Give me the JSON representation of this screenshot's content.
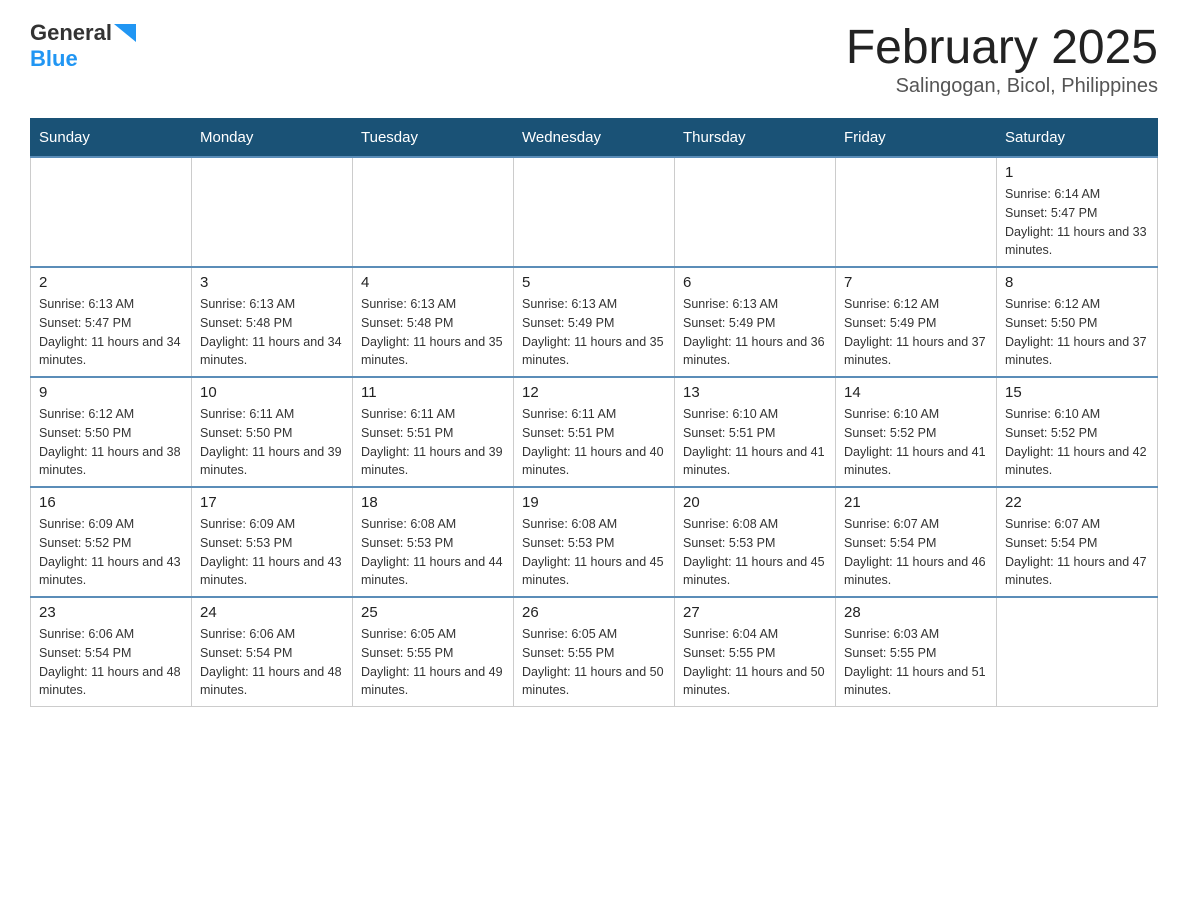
{
  "logo": {
    "general": "General",
    "blue": "Blue",
    "arrow": "▲"
  },
  "header": {
    "month": "February 2025",
    "location": "Salingogan, Bicol, Philippines"
  },
  "weekdays": [
    "Sunday",
    "Monday",
    "Tuesday",
    "Wednesday",
    "Thursday",
    "Friday",
    "Saturday"
  ],
  "weeks": [
    [
      {
        "day": "",
        "info": ""
      },
      {
        "day": "",
        "info": ""
      },
      {
        "day": "",
        "info": ""
      },
      {
        "day": "",
        "info": ""
      },
      {
        "day": "",
        "info": ""
      },
      {
        "day": "",
        "info": ""
      },
      {
        "day": "1",
        "info": "Sunrise: 6:14 AM\nSunset: 5:47 PM\nDaylight: 11 hours and 33 minutes."
      }
    ],
    [
      {
        "day": "2",
        "info": "Sunrise: 6:13 AM\nSunset: 5:47 PM\nDaylight: 11 hours and 34 minutes."
      },
      {
        "day": "3",
        "info": "Sunrise: 6:13 AM\nSunset: 5:48 PM\nDaylight: 11 hours and 34 minutes."
      },
      {
        "day": "4",
        "info": "Sunrise: 6:13 AM\nSunset: 5:48 PM\nDaylight: 11 hours and 35 minutes."
      },
      {
        "day": "5",
        "info": "Sunrise: 6:13 AM\nSunset: 5:49 PM\nDaylight: 11 hours and 35 minutes."
      },
      {
        "day": "6",
        "info": "Sunrise: 6:13 AM\nSunset: 5:49 PM\nDaylight: 11 hours and 36 minutes."
      },
      {
        "day": "7",
        "info": "Sunrise: 6:12 AM\nSunset: 5:49 PM\nDaylight: 11 hours and 37 minutes."
      },
      {
        "day": "8",
        "info": "Sunrise: 6:12 AM\nSunset: 5:50 PM\nDaylight: 11 hours and 37 minutes."
      }
    ],
    [
      {
        "day": "9",
        "info": "Sunrise: 6:12 AM\nSunset: 5:50 PM\nDaylight: 11 hours and 38 minutes."
      },
      {
        "day": "10",
        "info": "Sunrise: 6:11 AM\nSunset: 5:50 PM\nDaylight: 11 hours and 39 minutes."
      },
      {
        "day": "11",
        "info": "Sunrise: 6:11 AM\nSunset: 5:51 PM\nDaylight: 11 hours and 39 minutes."
      },
      {
        "day": "12",
        "info": "Sunrise: 6:11 AM\nSunset: 5:51 PM\nDaylight: 11 hours and 40 minutes."
      },
      {
        "day": "13",
        "info": "Sunrise: 6:10 AM\nSunset: 5:51 PM\nDaylight: 11 hours and 41 minutes."
      },
      {
        "day": "14",
        "info": "Sunrise: 6:10 AM\nSunset: 5:52 PM\nDaylight: 11 hours and 41 minutes."
      },
      {
        "day": "15",
        "info": "Sunrise: 6:10 AM\nSunset: 5:52 PM\nDaylight: 11 hours and 42 minutes."
      }
    ],
    [
      {
        "day": "16",
        "info": "Sunrise: 6:09 AM\nSunset: 5:52 PM\nDaylight: 11 hours and 43 minutes."
      },
      {
        "day": "17",
        "info": "Sunrise: 6:09 AM\nSunset: 5:53 PM\nDaylight: 11 hours and 43 minutes."
      },
      {
        "day": "18",
        "info": "Sunrise: 6:08 AM\nSunset: 5:53 PM\nDaylight: 11 hours and 44 minutes."
      },
      {
        "day": "19",
        "info": "Sunrise: 6:08 AM\nSunset: 5:53 PM\nDaylight: 11 hours and 45 minutes."
      },
      {
        "day": "20",
        "info": "Sunrise: 6:08 AM\nSunset: 5:53 PM\nDaylight: 11 hours and 45 minutes."
      },
      {
        "day": "21",
        "info": "Sunrise: 6:07 AM\nSunset: 5:54 PM\nDaylight: 11 hours and 46 minutes."
      },
      {
        "day": "22",
        "info": "Sunrise: 6:07 AM\nSunset: 5:54 PM\nDaylight: 11 hours and 47 minutes."
      }
    ],
    [
      {
        "day": "23",
        "info": "Sunrise: 6:06 AM\nSunset: 5:54 PM\nDaylight: 11 hours and 48 minutes."
      },
      {
        "day": "24",
        "info": "Sunrise: 6:06 AM\nSunset: 5:54 PM\nDaylight: 11 hours and 48 minutes."
      },
      {
        "day": "25",
        "info": "Sunrise: 6:05 AM\nSunset: 5:55 PM\nDaylight: 11 hours and 49 minutes."
      },
      {
        "day": "26",
        "info": "Sunrise: 6:05 AM\nSunset: 5:55 PM\nDaylight: 11 hours and 50 minutes."
      },
      {
        "day": "27",
        "info": "Sunrise: 6:04 AM\nSunset: 5:55 PM\nDaylight: 11 hours and 50 minutes."
      },
      {
        "day": "28",
        "info": "Sunrise: 6:03 AM\nSunset: 5:55 PM\nDaylight: 11 hours and 51 minutes."
      },
      {
        "day": "",
        "info": ""
      }
    ]
  ]
}
